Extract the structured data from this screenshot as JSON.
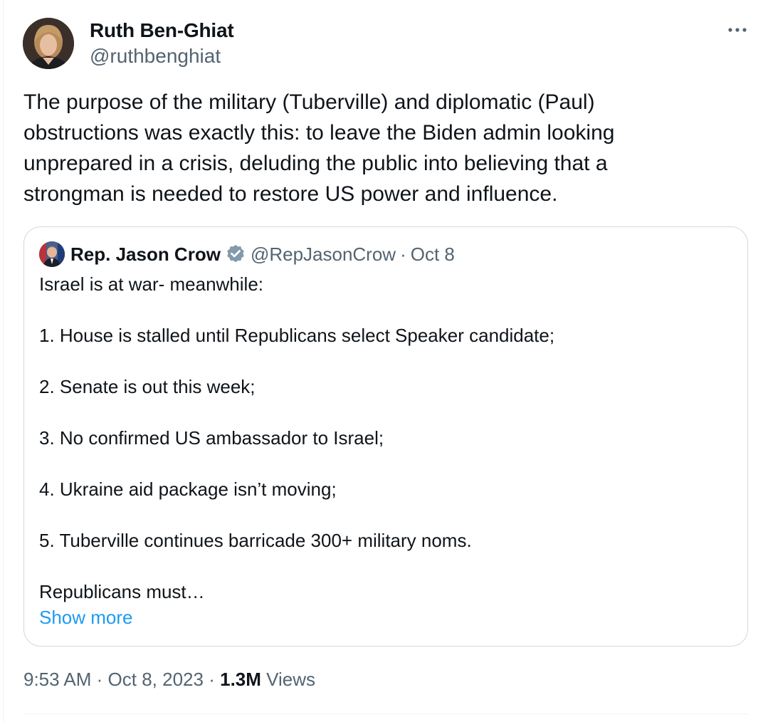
{
  "author": {
    "name": "Ruth Ben-Ghiat",
    "handle": "@ruthbenghiat"
  },
  "more_icon": "more-horizontal-icon",
  "tweet_text_lines": [
    "The purpose of the military (Tuberville) and diplomatic (Paul)",
    "obstructions was exactly this: to leave the Biden admin looking",
    "unprepared in a crisis, deluding the public into believing that a",
    "strongman is needed to restore US power and influence."
  ],
  "quote": {
    "name": "Rep. Jason Crow",
    "verified_icon": "verified-badge-icon",
    "handle": "@RepJasonCrow",
    "separator": "·",
    "date": "Oct 8",
    "lines": [
      "Israel is at war- meanwhile:",
      "1. House is stalled until Republicans select Speaker candidate;",
      "2. Senate is out this week;",
      "3. No confirmed US ambassador to Israel;",
      "4. Ukraine aid package isn’t moving;",
      "5. Tuberville continues barricade 300+ military noms.",
      "Republicans must…"
    ],
    "show_more": "Show more"
  },
  "meta": {
    "time": "9:53 AM",
    "separator": "·",
    "date": "Oct 8, 2023",
    "views_count": "1.3M",
    "views_label": "Views"
  },
  "colors": {
    "text_primary": "#0f1419",
    "text_secondary": "#536471",
    "link": "#1d9bf0",
    "border": "#cfd9de",
    "verified": "#829aab"
  }
}
